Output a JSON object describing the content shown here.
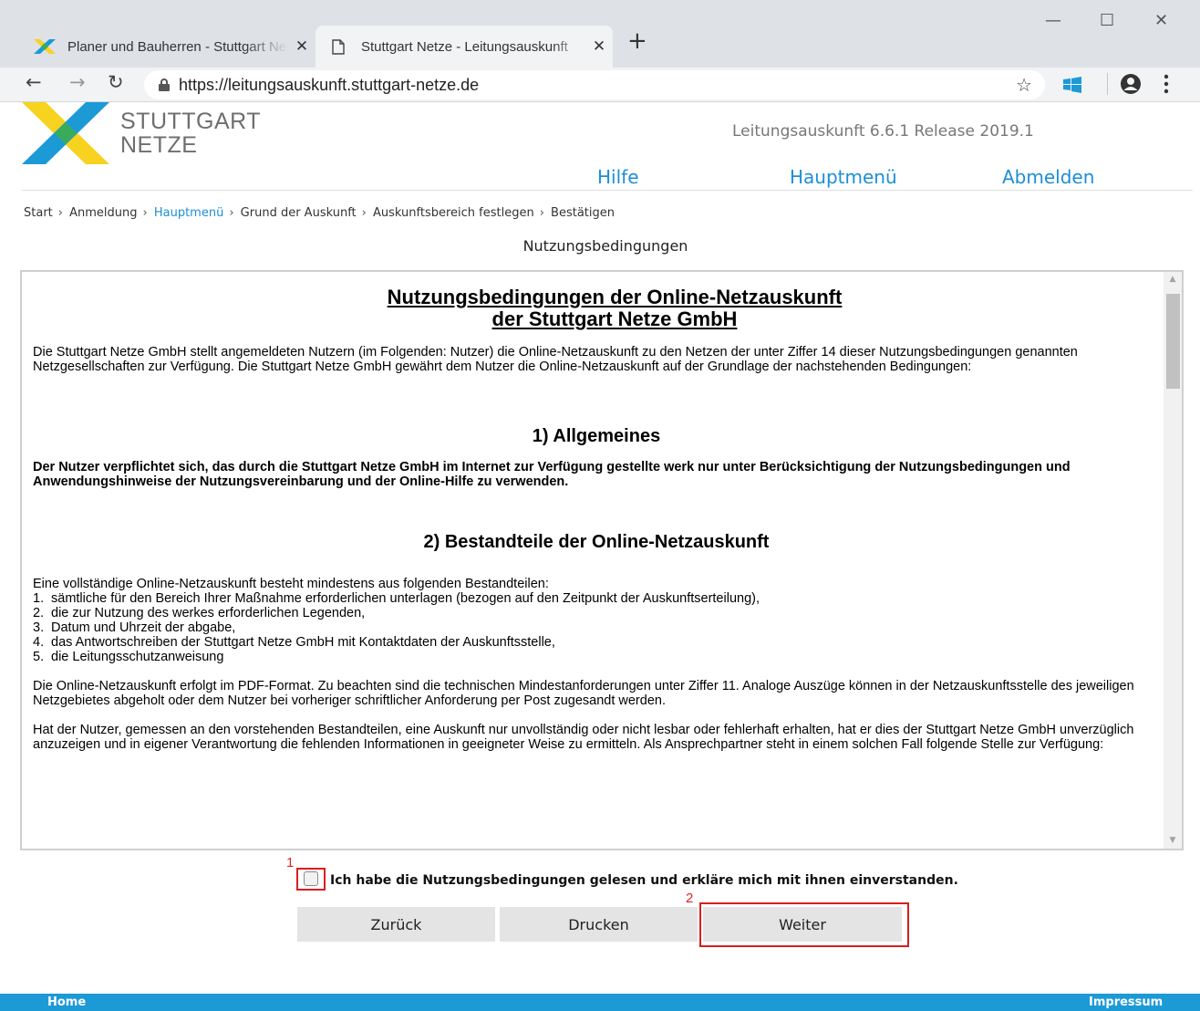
{
  "browser": {
    "tabs": [
      {
        "title": "Planer und Bauherren - Stuttgart Netze",
        "active": false
      },
      {
        "title": "Stuttgart Netze - Leitungsauskunft",
        "active": true
      }
    ],
    "url": "https://leitungsauskunft.stuttgart-netze.de",
    "icons": {
      "new_tab": "plus-icon",
      "close": "close-icon",
      "minimize": "minimize-icon",
      "maximize": "maximize-icon",
      "bookmark": "star-icon",
      "windows": "windows-icon",
      "profile": "account-icon",
      "menu": "kebab-menu-icon"
    }
  },
  "header": {
    "logo_line1": "STUTTGART",
    "logo_line2": "NETZE",
    "release": "Leitungsauskunft 6.6.1 Release 2019.1",
    "links": {
      "help": "Hilfe",
      "main_menu": "Hauptmenü",
      "logout": "Abmelden"
    },
    "colors": {
      "link": "#1c8fd6",
      "logo_yellow": "#f7d21f",
      "logo_blue": "#1c9ad6",
      "logo_green": "#3aab5a"
    }
  },
  "breadcrumb": [
    {
      "label": "Start",
      "link": false
    },
    {
      "label": "Anmeldung",
      "link": false
    },
    {
      "label": "Hauptmenü",
      "link": true
    },
    {
      "label": "Grund der Auskunft",
      "link": false
    },
    {
      "label": "Auskunftsbereich festlegen",
      "link": false
    },
    {
      "label": "Bestätigen",
      "link": false
    }
  ],
  "page_title": "Nutzungsbedingungen",
  "terms": {
    "title_line1": "Nutzungsbedingungen der Online-Netzauskunft",
    "title_line2": "der Stuttgart Netze GmbH",
    "intro": "Die Stuttgart Netze GmbH stellt angemeldeten Nutzern (im Folgenden: Nutzer) die Online-Netzauskunft zu den Netzen der unter Ziffer 14 dieser Nutzungsbedingungen genannten Netzgesellschaften zur Verfügung. Die Stuttgart Netze GmbH gewährt dem Nutzer die Online-Netzauskunft auf der Grundlage der nachstehenden Bedingungen:",
    "section1_heading": "1) Allgemeines",
    "section1_text": "Der Nutzer verpflichtet sich, das durch die Stuttgart Netze GmbH im Internet zur Verfügung gestellte werk nur unter Berücksichtigung der Nutzungsbedingungen und Anwendungshinweise der Nutzungsvereinbarung und der Online-Hilfe zu verwenden.",
    "section2_heading": "2) Bestandteile der Online-Netzauskunft",
    "section2_intro": "Eine vollständige Online-Netzauskunft besteht mindestens aus folgenden Bestandteilen:",
    "section2_items": [
      {
        "num": "1.",
        "text": "sämtliche für den Bereich Ihrer Maßnahme erforderlichen unterlagen (bezogen auf den Zeitpunkt der Auskunftserteilung),"
      },
      {
        "num": "2.",
        "text": "die zur Nutzung des werkes erforderlichen Legenden,"
      },
      {
        "num": "3.",
        "text": "Datum und Uhrzeit der abgabe,"
      },
      {
        "num": "4.",
        "text": "das Antwortschreiben der Stuttgart Netze GmbH mit Kontaktdaten der Auskunftsstelle,"
      },
      {
        "num": "5.",
        "text": "die Leitungsschutzanweisung"
      }
    ],
    "section2_p2": "Die Online-Netzauskunft erfolgt im PDF-Format. Zu beachten sind die technischen Mindestanforderungen unter Ziffer 11. Analoge Auszüge können in der Netzauskunftsstelle des jeweiligen Netzgebietes abgeholt oder dem Nutzer bei vorheriger schriftlicher Anforderung per Post zugesandt werden.",
    "section2_p3": "Hat der Nutzer, gemessen an den vorstehenden Bestandteilen, eine Auskunft nur unvollständig oder nicht lesbar oder fehlerhaft erhalten, hat er dies der Stuttgart Netze GmbH unverzüglich anzuzeigen und in eigener Verantwortung die fehlenden Informationen in geeigneter Weise zu ermitteln. Als Ansprechpartner steht in einem solchen Fall folgende Stelle zur Verfügung:"
  },
  "agreement": {
    "label": "Ich habe die Nutzungsbedingungen gelesen und erkläre mich mit ihnen einverstanden.",
    "checked": false
  },
  "buttons": {
    "back": "Zurück",
    "print": "Drucken",
    "next": "Weiter"
  },
  "callouts": {
    "one": "1",
    "two": "2",
    "color": "#d81e1e"
  },
  "footer": {
    "home": "Home",
    "imprint": "Impressum",
    "color": "#1c9ad6"
  }
}
